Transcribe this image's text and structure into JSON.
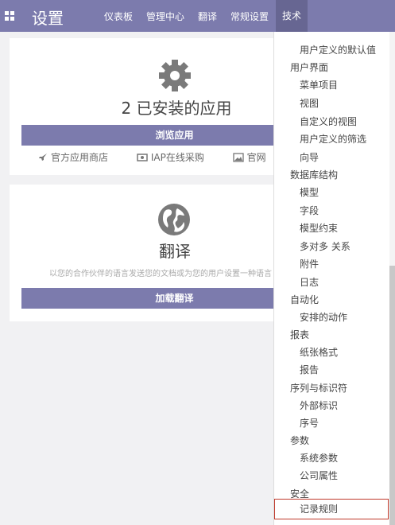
{
  "header": {
    "title": "设置",
    "nav": [
      "仪表板",
      "管理中心",
      "翻译",
      "常规设置",
      "技术"
    ]
  },
  "apps_card": {
    "count_text": "2 已安装的应用",
    "browse_button": "浏览应用",
    "links": [
      "官方应用商店",
      "IAP在线采购",
      "官网"
    ]
  },
  "translation_card": {
    "title": "翻译",
    "description": "以您的合作伙伴的语言发送您的文档或为您的用户设置一种语言",
    "load_button": "加载翻译"
  },
  "dropdown": {
    "items": [
      {
        "label": "用户定义的默认值",
        "kind": "sub"
      },
      {
        "label": "用户界面",
        "kind": "header"
      },
      {
        "label": "菜单项目",
        "kind": "sub"
      },
      {
        "label": "视图",
        "kind": "sub"
      },
      {
        "label": "自定义的视图",
        "kind": "sub"
      },
      {
        "label": "用户定义的筛选",
        "kind": "sub"
      },
      {
        "label": "向导",
        "kind": "sub"
      },
      {
        "label": "数据库结构",
        "kind": "header"
      },
      {
        "label": "模型",
        "kind": "sub"
      },
      {
        "label": "字段",
        "kind": "sub"
      },
      {
        "label": "模型约束",
        "kind": "sub"
      },
      {
        "label": "多对多 关系",
        "kind": "sub"
      },
      {
        "label": "附件",
        "kind": "sub"
      },
      {
        "label": "日志",
        "kind": "sub"
      },
      {
        "label": "自动化",
        "kind": "header"
      },
      {
        "label": "安排的动作",
        "kind": "sub"
      },
      {
        "label": "报表",
        "kind": "header"
      },
      {
        "label": "纸张格式",
        "kind": "sub"
      },
      {
        "label": "报告",
        "kind": "sub"
      },
      {
        "label": "序列与标识符",
        "kind": "header"
      },
      {
        "label": "外部标识",
        "kind": "sub"
      },
      {
        "label": "序号",
        "kind": "sub"
      },
      {
        "label": "参数",
        "kind": "header"
      },
      {
        "label": "系统参数",
        "kind": "sub"
      },
      {
        "label": "公司属性",
        "kind": "sub"
      },
      {
        "label": "安全",
        "kind": "header"
      },
      {
        "label": "记录规则",
        "kind": "sub",
        "selected": true
      }
    ]
  },
  "colors": {
    "brand": "#7c7bad",
    "active_tab": "#676692",
    "highlight_border": "#c0392b"
  }
}
